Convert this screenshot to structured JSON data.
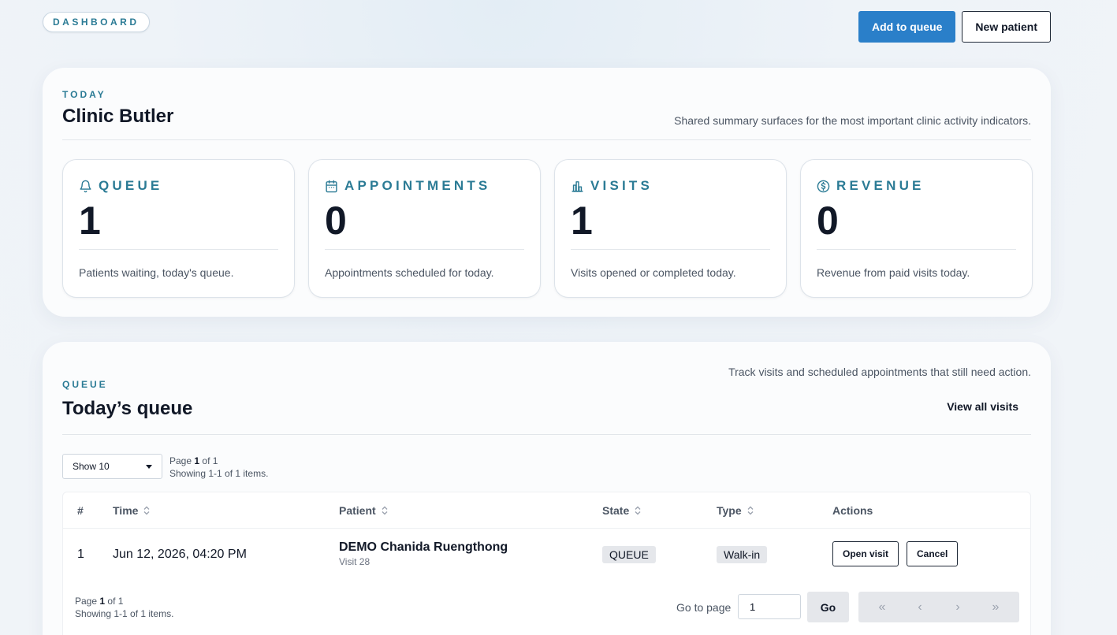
{
  "header": {
    "badge": "DASHBOARD",
    "add_to_queue_label": "Add to queue",
    "new_patient_label": "New patient"
  },
  "summary": {
    "eyebrow": "TODAY",
    "title": "Clinic Butler",
    "description": "Shared summary surfaces for the most important clinic activity indicators.",
    "stats": [
      {
        "title": "QUEUE",
        "icon": "bell-icon",
        "value": "1",
        "note": "Patients waiting, today's queue."
      },
      {
        "title": "APPOINTMENTS",
        "icon": "calendar-icon",
        "value": "0",
        "note": "Appointments scheduled for today."
      },
      {
        "title": "VISITS",
        "icon": "bar-chart-icon",
        "value": "1",
        "note": "Visits opened or completed today."
      },
      {
        "title": "REVENUE",
        "icon": "dollar-circle-icon",
        "value": "0",
        "note": "Revenue from paid visits today."
      }
    ]
  },
  "queue": {
    "eyebrow": "QUEUE",
    "title": "Today’s queue",
    "description": "Track visits and scheduled appointments that still need action.",
    "view_all_label": "View all visits",
    "show_select": "Show 10",
    "page_label": "Page",
    "page_current": "1",
    "page_of": "of 1",
    "showing": "Showing 1-1 of 1 items.",
    "columns": [
      "#",
      "Time",
      "Patient",
      "State",
      "Type",
      "Actions"
    ],
    "rows": [
      {
        "index": "1",
        "time": "Jun 12, 2026, 04:20 PM",
        "patient": "DEMO Chanida Ruengthong",
        "visit": "Visit 28",
        "state": "QUEUE",
        "type": "Walk-in",
        "open_label": "Open visit",
        "cancel_label": "Cancel"
      }
    ],
    "goto_label": "Go to page",
    "goto_value": "1",
    "go_label": "Go",
    "pager": {
      "first": "«",
      "prev": "‹",
      "next": "›",
      "last": "»"
    }
  },
  "colors": {
    "accent": "#2b7b95",
    "primary_button": "#2a7fc9",
    "tag_bg": "#e5e7eb"
  }
}
